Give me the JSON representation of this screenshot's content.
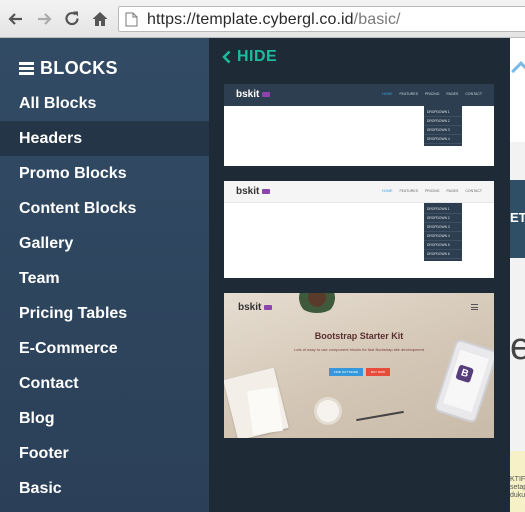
{
  "browser": {
    "url_host": "https://template.cybergl.co.id",
    "url_path": "/basic/"
  },
  "sidebar": {
    "title": "BLOCKS",
    "items": [
      {
        "label": "All Blocks",
        "active": false
      },
      {
        "label": "Headers",
        "active": true
      },
      {
        "label": "Promo Blocks",
        "active": false
      },
      {
        "label": "Content Blocks",
        "active": false
      },
      {
        "label": "Gallery",
        "active": false
      },
      {
        "label": "Team",
        "active": false
      },
      {
        "label": "Pricing Tables",
        "active": false
      },
      {
        "label": "E-Commerce",
        "active": false
      },
      {
        "label": "Contact",
        "active": false
      },
      {
        "label": "Blog",
        "active": false
      },
      {
        "label": "Footer",
        "active": false
      },
      {
        "label": "Basic",
        "active": false
      }
    ]
  },
  "panel": {
    "hide_label": "HIDE",
    "thumb_logo": "bskit",
    "nav_links": [
      "HOME",
      "FEATURES",
      "PRICING",
      "PAGES",
      "CONTACT"
    ],
    "dropdown1": [
      "DROPDOWN 1",
      "DROPDOWN 2",
      "DROPDOWN 3",
      "DROPDOWN 4"
    ],
    "dropdown2": [
      "DROPDOWN 1",
      "DROPDOWN 2",
      "DROPDOWN 3",
      "DROPDOWN 4",
      "DROPDOWN 5",
      "DROPDOWN 6"
    ],
    "hero_title": "Bootstrap Starter Kit",
    "hero_subtitle": "Lots of easy to use component blocks for fast Bootstrap site development",
    "hero_button1": "FIND OUT MORE",
    "hero_button2": "BUY NOW",
    "hero_tablet_letter": "B"
  },
  "page_peek": {
    "bar_text": "ET",
    "big_text": "e",
    "low_text": "KTIF setap dukung"
  },
  "colors": {
    "sidebar_bg": "#2f4660",
    "sidebar_active": "#243547",
    "panel_bg": "#1e2b37",
    "accent": "#1abc9c"
  }
}
